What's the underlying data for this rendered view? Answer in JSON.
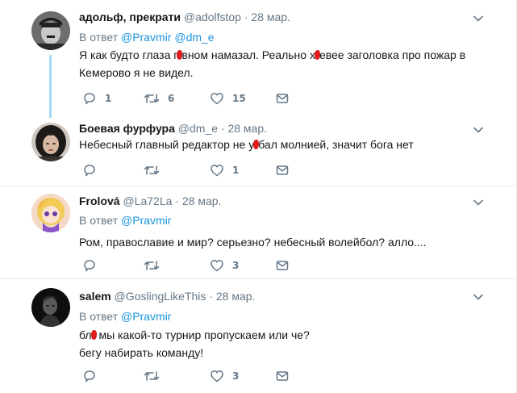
{
  "tweets": [
    {
      "name": "адольф, прекрати",
      "handle": "@adolfstop",
      "dot": "·",
      "time": "28 мар.",
      "reply_prefix": "В ответ",
      "reply_mentions": [
        "@Pravmir",
        "@dm_e"
      ],
      "lines": [
        [
          "Я как будто глаза г",
          "вном намазал. Реально х",
          "евее заголовка про пожар в"
        ],
        [
          "Кемерово я не видел."
        ]
      ],
      "replies": "1",
      "retweets": "6",
      "likes": "15"
    },
    {
      "name": "Боевая фурфура",
      "handle": "@dm_e",
      "dot": "·",
      "time": "28 мар.",
      "lines": [
        [
          "Небесный главный редактор не у",
          "бал молнией, значит бога нет"
        ]
      ],
      "replies": "",
      "retweets": "",
      "likes": "1"
    },
    {
      "name": "Frolová",
      "handle": "@La72La",
      "dot": "·",
      "time": "28 мар.",
      "reply_prefix": "В ответ",
      "reply_mentions": [
        "@Pravmir"
      ],
      "lines": [
        [
          "Ром, православие и мир? серьезно? небесный волейбол? алло...."
        ]
      ],
      "replies": "",
      "retweets": "",
      "likes": "3"
    },
    {
      "name": "salem",
      "handle": "@GoslingLikeThis",
      "dot": "·",
      "time": "28 мар.",
      "reply_prefix": "В ответ",
      "reply_mentions": [
        "@Pravmir"
      ],
      "lines": [
        [
          "бл",
          " мы какой-то турнир пропускаем или че?"
        ],
        [
          "бегу набирать команду!"
        ]
      ],
      "replies": "",
      "retweets": "",
      "likes": "3"
    }
  ],
  "icons": [
    "chevron-down-icon",
    "reply-icon",
    "retweet-icon",
    "heart-icon",
    "envelope-icon"
  ],
  "colors": {
    "text": "#14171a",
    "secondary": "#657786",
    "link": "#1b95e0",
    "thread_line": "#a4d9f5",
    "censor_blot": "#e01c1c",
    "divider": "#e6ecf0"
  }
}
